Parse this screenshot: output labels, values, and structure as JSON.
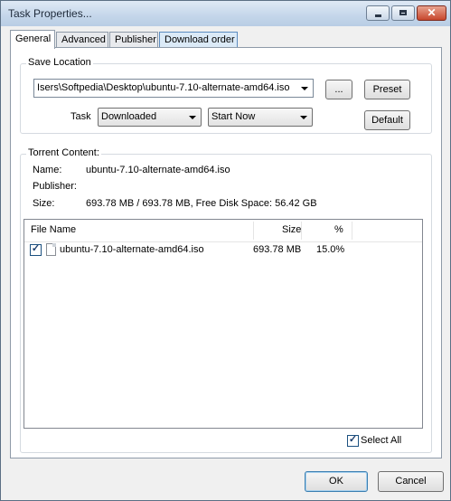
{
  "window": {
    "title": "Task Properties..."
  },
  "tabs": [
    {
      "label": "General"
    },
    {
      "label": "Advanced"
    },
    {
      "label": "Publisher"
    },
    {
      "label": "Download order"
    }
  ],
  "save_location": {
    "group_label": "Save Location",
    "path_value": "Isers\\Softpedia\\Desktop\\ubuntu-7.10-alternate-amd64.iso",
    "browse_label": "...",
    "preset_label": "Preset",
    "task_label": "Task",
    "task_value": "Downloaded",
    "start_value": "Start Now",
    "default_label": "Default"
  },
  "torrent": {
    "group_label": "Torrent Content:",
    "name_label": "Name:",
    "name_value": "ubuntu-7.10-alternate-amd64.iso",
    "publisher_label": "Publisher:",
    "publisher_value": "",
    "size_label": "Size:",
    "size_value": "693.78 MB / 693.78 MB, Free Disk Space: 56.42 GB"
  },
  "file_list": {
    "columns": {
      "name": "File Name",
      "size": "Size",
      "pct": "%"
    },
    "rows": [
      {
        "name": "ubuntu-7.10-alternate-amd64.iso",
        "size": "693.78 MB",
        "pct": "15.0%",
        "checked": true
      }
    ]
  },
  "select_all": {
    "label": "Select All",
    "checked": true
  },
  "buttons": {
    "ok": "OK",
    "cancel": "Cancel"
  },
  "colors": {
    "title_bar": "#c4d6ea",
    "close_button": "#c7462d",
    "default_button_border": "#3c7fb1"
  }
}
